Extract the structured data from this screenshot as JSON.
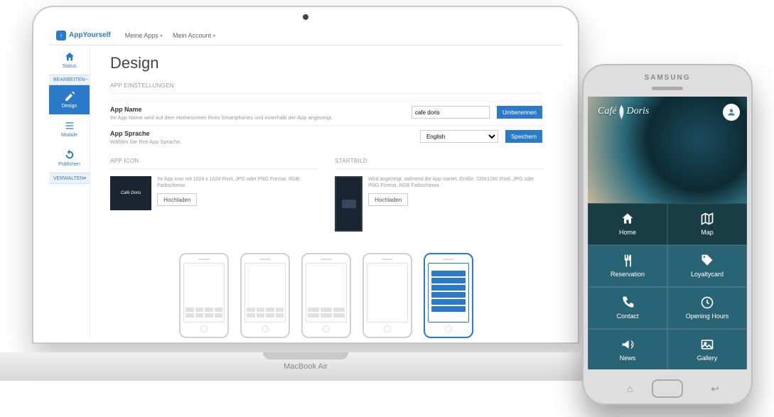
{
  "brand": "AppYourself",
  "top_menu": [
    "Meine Apps",
    "Mein Account"
  ],
  "sidebar": {
    "items": [
      {
        "label": "Status"
      },
      {
        "label": "Design"
      },
      {
        "label": "Module"
      },
      {
        "label": "Publishen"
      }
    ],
    "sections": {
      "bearbeiten": "BEARBEITEN",
      "verwalten": "VERWALTEN"
    }
  },
  "page": {
    "title": "Design",
    "section_app_settings": "APP EINSTELLUNGEN",
    "app_name": {
      "label": "App Name",
      "help": "Ihr App Name wird auf dem Homescreen Ihres Smartphones und innerhalb der App angezeigt.",
      "value": "cafe doris",
      "button": "Umbenennen"
    },
    "app_lang": {
      "label": "App Sprache",
      "help": "Wählen Sie Ihre App Sprache.",
      "value": "English",
      "button": "Speichern"
    },
    "section_app_icon": "APP ICON",
    "app_icon": {
      "preview_text": "Café Doris",
      "desc": "Ihr App Icon mit 1024 x 1024 Pixel, JPG oder PNG Format, RGB Farbschema",
      "button": "Hochladen"
    },
    "section_startbild": "STARTBILD",
    "startbild": {
      "desc": "Wird angezeigt, während die App startet. Größe: 720x1280 Pixel, JPG oder PNG Format, RGB Farbschema",
      "button": "Hochladen"
    }
  },
  "macbook_label": "MacBook Air",
  "phone": {
    "brand": "SAMSUNG",
    "hero_logo": "Café Doris",
    "tiles": [
      {
        "label": "Home"
      },
      {
        "label": "Map"
      },
      {
        "label": "Reservation"
      },
      {
        "label": "Loyaltycard"
      },
      {
        "label": "Contact"
      },
      {
        "label": "Opening Hours"
      },
      {
        "label": "News"
      },
      {
        "label": "Gallery"
      }
    ]
  }
}
